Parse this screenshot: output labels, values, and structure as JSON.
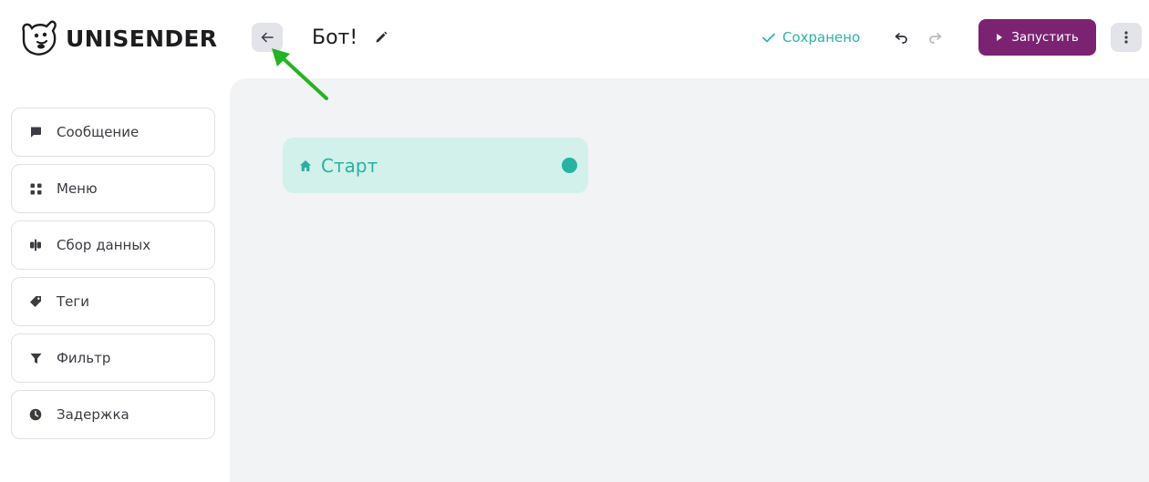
{
  "header": {
    "logo_text": "UNISENDER",
    "bot_title": "Бот!",
    "saved_label": "Сохранено",
    "run_label": "Запустить"
  },
  "sidebar": {
    "items": [
      {
        "label": "Сообщение",
        "icon": "message-icon"
      },
      {
        "label": "Меню",
        "icon": "grid-icon"
      },
      {
        "label": "Сбор данных",
        "icon": "data-collection-icon"
      },
      {
        "label": "Теги",
        "icon": "tag-icon"
      },
      {
        "label": "Фильтр",
        "icon": "filter-icon"
      },
      {
        "label": "Задержка",
        "icon": "clock-icon"
      }
    ]
  },
  "canvas": {
    "start_node_label": "Старт"
  },
  "colors": {
    "accent_teal": "#2bb3a8",
    "run_button": "#7b2372",
    "start_node_bg": "#d2f1ea",
    "annotation_arrow": "#22b422"
  }
}
